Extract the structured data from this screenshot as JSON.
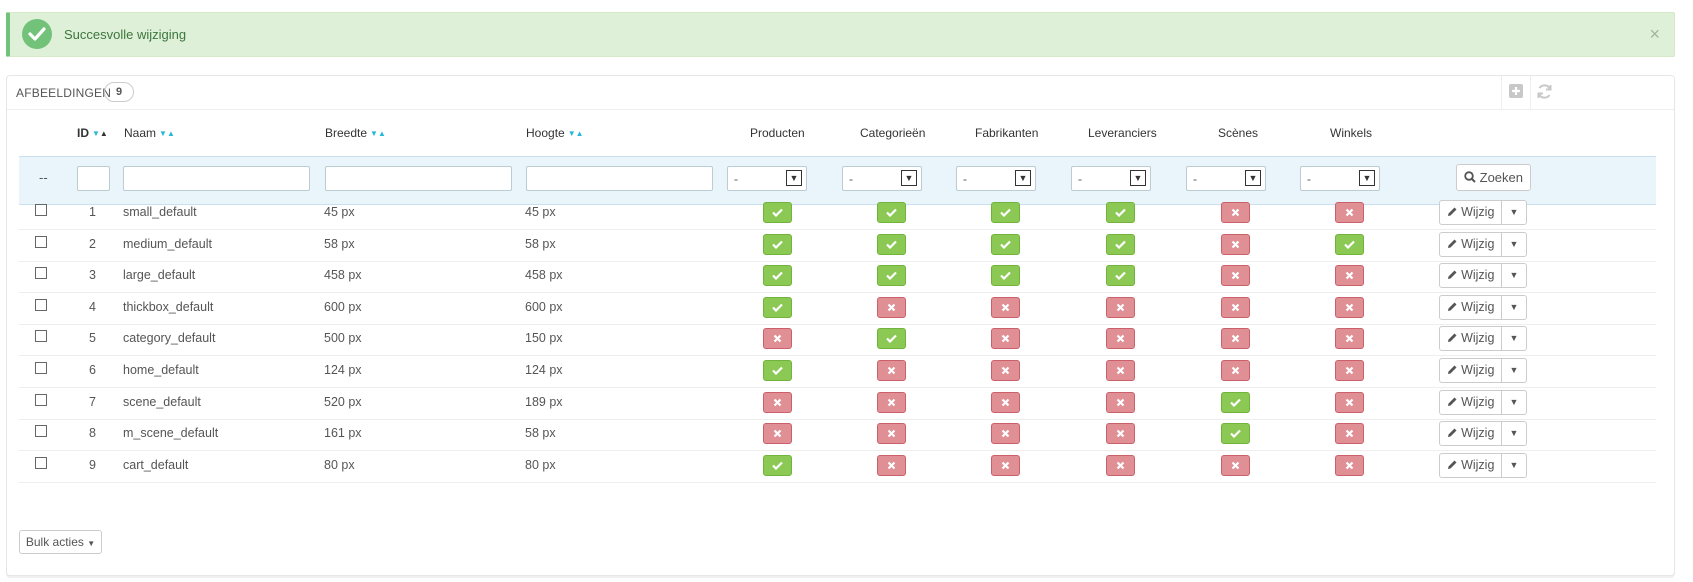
{
  "alert": {
    "message": "Succesvolle wijziging",
    "close_label": "×",
    "color": "#dff0d8"
  },
  "panel": {
    "title": "AFBEELDINGEN",
    "count": "9"
  },
  "columns": {
    "id": "ID",
    "name": "Naam",
    "width": "Breedte",
    "height": "Hoogte",
    "products": "Producten",
    "categories": "Categorieën",
    "manufacturers": "Fabrikanten",
    "suppliers": "Leveranciers",
    "scenes": "Scènes",
    "shops": "Winkels"
  },
  "filters": {
    "dash": "--",
    "select_value": "-",
    "search_label": "Zoeken"
  },
  "rows": [
    {
      "id": "1",
      "name": "small_default",
      "width": "45 px",
      "height": "45 px",
      "flags": [
        true,
        true,
        true,
        true,
        false,
        false
      ]
    },
    {
      "id": "2",
      "name": "medium_default",
      "width": "58 px",
      "height": "58 px",
      "flags": [
        true,
        true,
        true,
        true,
        false,
        true
      ]
    },
    {
      "id": "3",
      "name": "large_default",
      "width": "458 px",
      "height": "458 px",
      "flags": [
        true,
        true,
        true,
        true,
        false,
        false
      ]
    },
    {
      "id": "4",
      "name": "thickbox_default",
      "width": "600 px",
      "height": "600 px",
      "flags": [
        true,
        false,
        false,
        false,
        false,
        false
      ]
    },
    {
      "id": "5",
      "name": "category_default",
      "width": "500 px",
      "height": "150 px",
      "flags": [
        false,
        true,
        false,
        false,
        false,
        false
      ]
    },
    {
      "id": "6",
      "name": "home_default",
      "width": "124 px",
      "height": "124 px",
      "flags": [
        true,
        false,
        false,
        false,
        false,
        false
      ]
    },
    {
      "id": "7",
      "name": "scene_default",
      "width": "520 px",
      "height": "189 px",
      "flags": [
        false,
        false,
        false,
        false,
        true,
        false
      ]
    },
    {
      "id": "8",
      "name": "m_scene_default",
      "width": "161 px",
      "height": "58 px",
      "flags": [
        false,
        false,
        false,
        false,
        true,
        false
      ]
    },
    {
      "id": "9",
      "name": "cart_default",
      "width": "80 px",
      "height": "80 px",
      "flags": [
        true,
        false,
        false,
        false,
        false,
        false
      ]
    }
  ],
  "row_actions": {
    "edit_label": "Wijzig"
  },
  "bulk": {
    "label": "Bulk acties"
  },
  "colors": {
    "enabled": "#8bc954",
    "disabled": "#e08f95",
    "accent": "#25b9d7"
  }
}
